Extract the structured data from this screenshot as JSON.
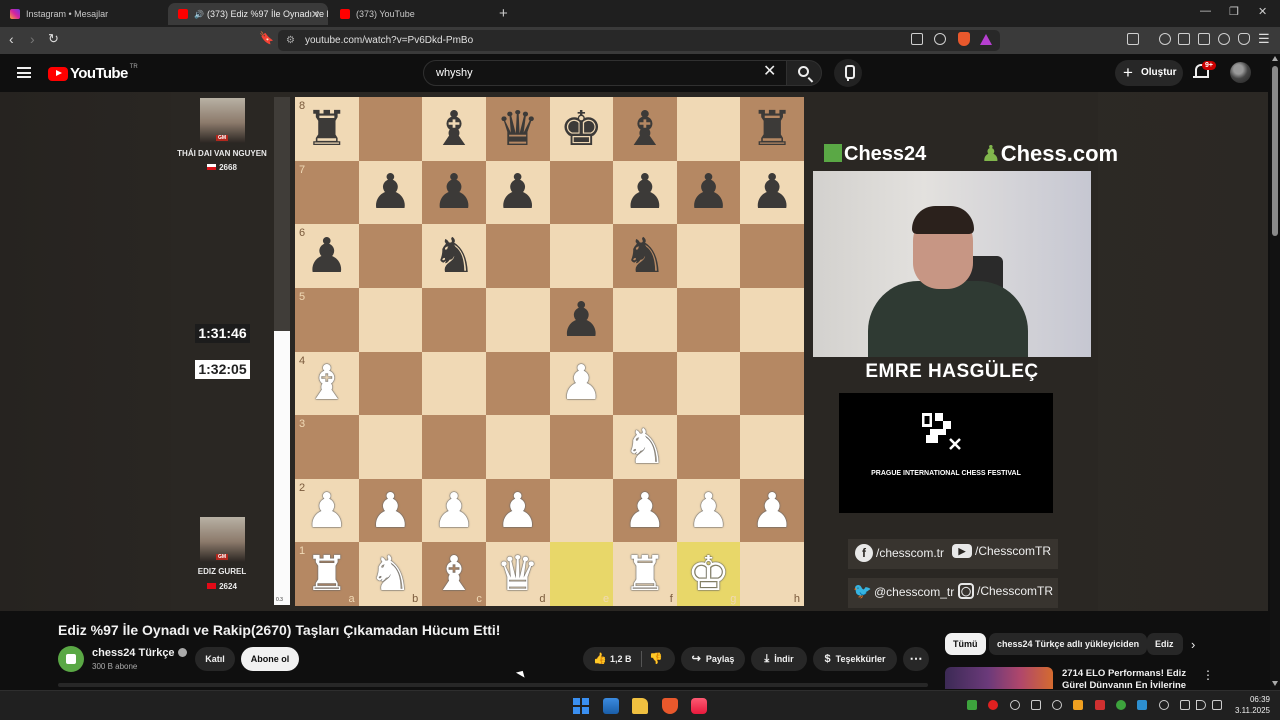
{
  "browser": {
    "tabs": [
      {
        "title": "Instagram • Mesajlar",
        "icon": "instagram-icon",
        "active": false
      },
      {
        "title": "(373) Ediz %97 İle Oynadı ve R",
        "icon": "youtube-icon",
        "active": true
      },
      {
        "title": "(373) YouTube",
        "icon": "youtube-icon",
        "active": false
      }
    ],
    "new_tab": "+",
    "url": "youtube.com/watch?v=Pv6Dkd-PmBo"
  },
  "youtube": {
    "logo_text": "YouTube",
    "region": "TR",
    "search_value": "whyshy",
    "create_label": "Oluştur",
    "notification_badge": "9+"
  },
  "video": {
    "top_player": {
      "name": "THÁI DAI VAN NGUYEN",
      "rating": "2668",
      "title_badge": "GM"
    },
    "bottom_player": {
      "name": "EDIZ GUREL",
      "rating": "2624",
      "title_badge": "GM"
    },
    "clock_black": "1:31:46",
    "clock_white": "1:32:05",
    "eval": "0.3",
    "eval_black_fraction": 0.46,
    "files": [
      "a",
      "b",
      "c",
      "d",
      "e",
      "f",
      "g",
      "h"
    ],
    "ranks": [
      "8",
      "7",
      "6",
      "5",
      "4",
      "3",
      "2",
      "1"
    ],
    "board": [
      [
        "r",
        "",
        "b",
        "q",
        "k",
        "b",
        "",
        "r"
      ],
      [
        "",
        "p",
        "p",
        "p",
        "",
        "p",
        "p",
        "p"
      ],
      [
        "p",
        "",
        "n",
        "",
        "",
        "n",
        "",
        ""
      ],
      [
        "",
        "",
        "",
        "",
        "p",
        "",
        "",
        ""
      ],
      [
        "B",
        "",
        "",
        "",
        "P",
        "",
        "",
        ""
      ],
      [
        "",
        "",
        "",
        "",
        "",
        "N",
        "",
        ""
      ],
      [
        "P",
        "P",
        "P",
        "P",
        "",
        "P",
        "P",
        "P"
      ],
      [
        "R",
        "N",
        "B",
        "Q",
        "",
        "R",
        "K",
        ""
      ]
    ],
    "highlighted_squares": [
      "e1",
      "g1"
    ],
    "brands": {
      "left": "Chess24",
      "right": "Chess.com"
    },
    "streamer_name": "EMRE HASGÜLEÇ",
    "festival_text": "PRAGUE INTERNATIONAL CHESS FESTIVAL",
    "socials": [
      {
        "icon": "facebook-icon",
        "text": "/chesscom.tr"
      },
      {
        "icon": "youtube-icon",
        "text": "/ChesscomTR"
      },
      {
        "icon": "twitter-icon",
        "text": "@chesscom_tr"
      },
      {
        "icon": "instagram-icon",
        "text": "/ChesscomTR"
      }
    ]
  },
  "meta": {
    "title": "Ediz %97 İle Oynadı ve Rakip(2670) Taşları Çıkamadan Hücum Etti!",
    "channel": "chess24 Türkçe",
    "subscribers": "300 B abone",
    "join_label": "Katıl",
    "subscribe_label": "Abone ol",
    "likes": "1,2 B",
    "share_label": "Paylaş",
    "download_label": "İndir",
    "thanks_label": "Teşekkürler"
  },
  "sidebar": {
    "chips": [
      "Tümü",
      "chess24 Türkçe adlı yükleyiciden",
      "Ediz"
    ],
    "recommendation_title": "2714 ELO Performans! Ediz Gürel Dünyanın En İyilerine"
  },
  "taskbar": {
    "time": "06:39",
    "date": "3.11.2025"
  },
  "colors": {
    "light_square": "#f0d9b5",
    "dark_square": "#b58863",
    "highlight": "#e8d769",
    "youtube_red": "#ff0000",
    "chess24_green": "#5aa845"
  }
}
